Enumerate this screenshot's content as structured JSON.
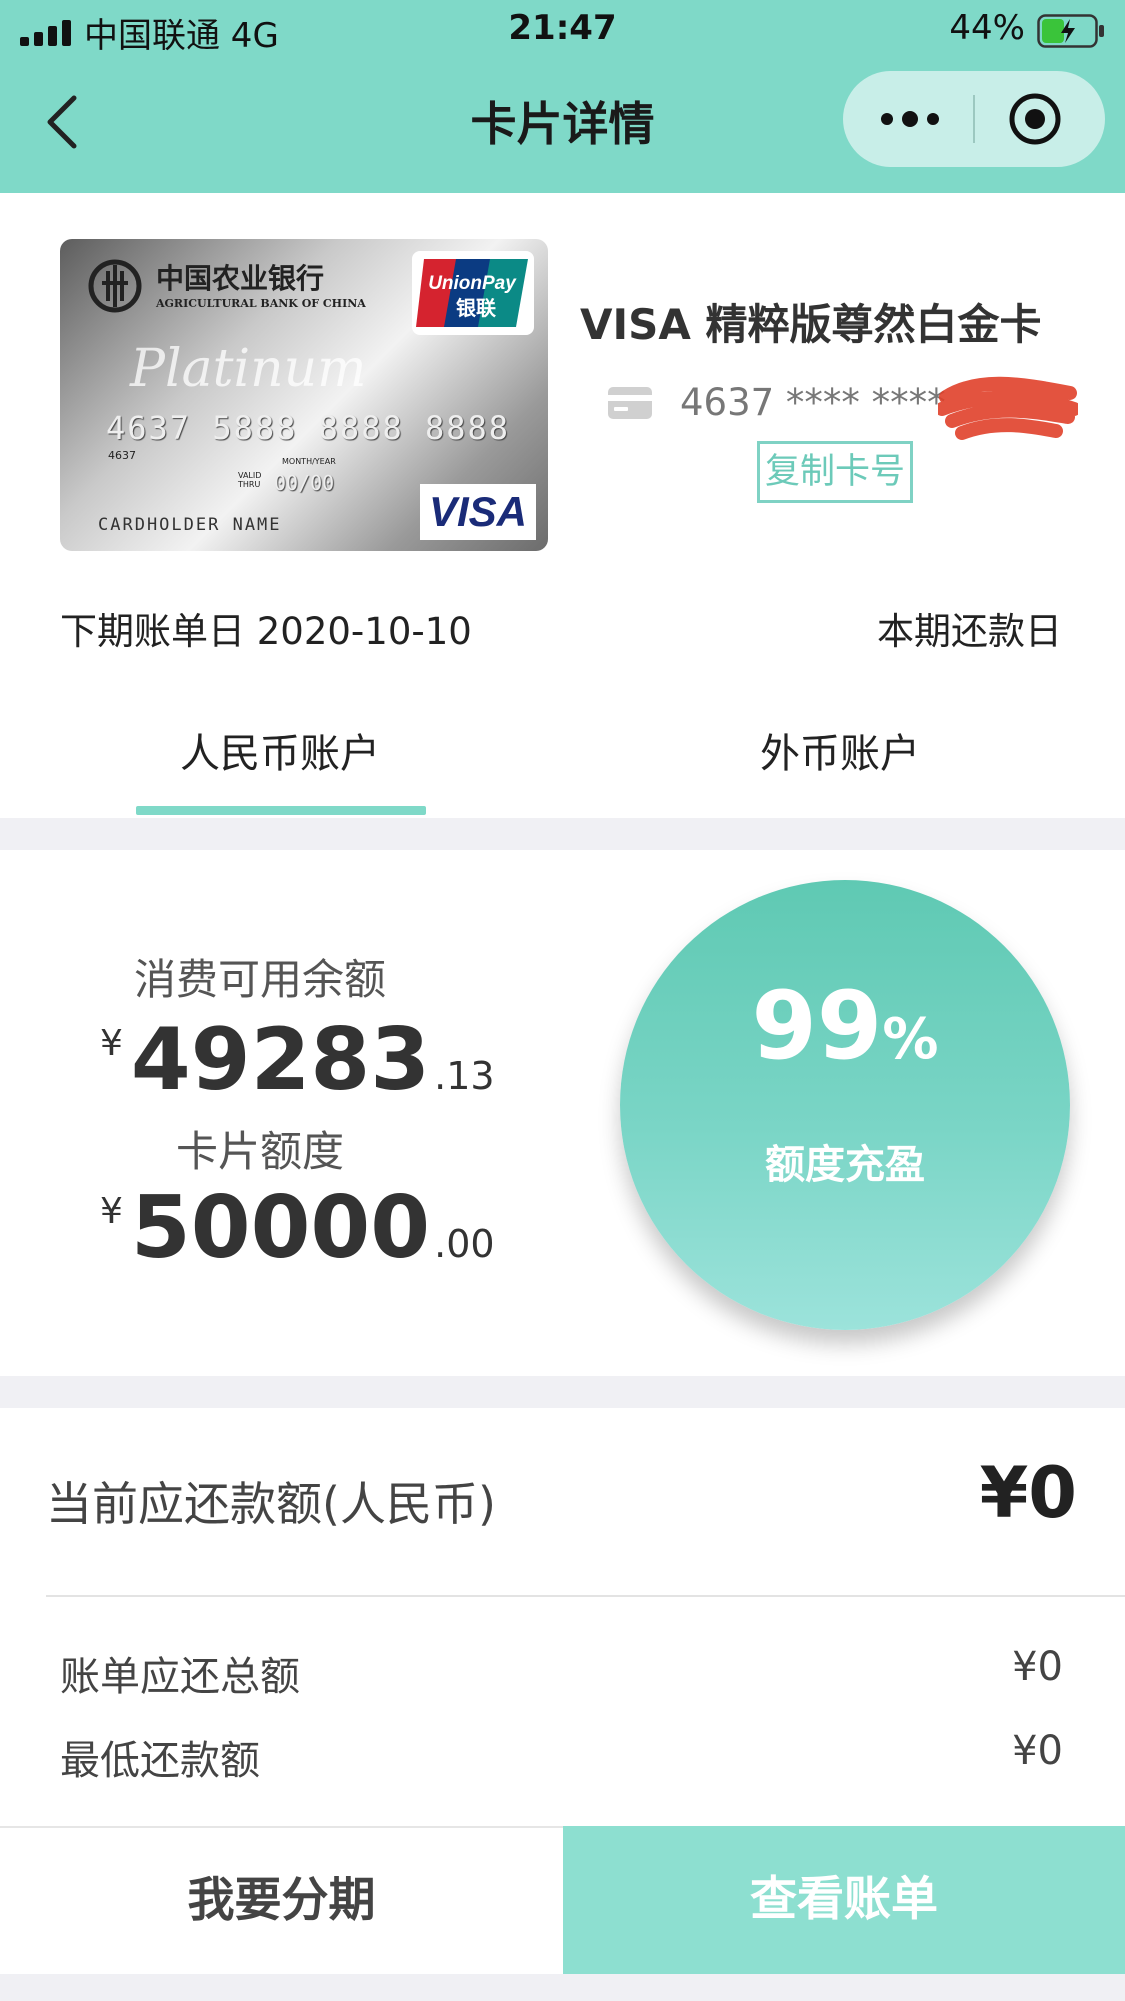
{
  "status_bar": {
    "carrier": "中国联通  4G",
    "time": "21:47",
    "battery_percent": "44%",
    "battery_level": 0.44
  },
  "nav": {
    "title": "卡片详情",
    "back_icon": "chevron-left-icon",
    "more_icon": "more-dots-icon",
    "close_icon": "target-circle-icon"
  },
  "card": {
    "image": {
      "bank_name_cn": "中国农业银行",
      "bank_name_en": "AGRICULTURAL BANK OF CHINA",
      "tier": "Platinum",
      "number": "4637 5888 8888 8888",
      "small_number": "4637",
      "valid_thru_label": "VALID THRU",
      "month_year_label": "MONTH/YEAR",
      "valid_date": "00/00",
      "holder": "CARDHOLDER  NAME",
      "unionpay_en": "UnionPay",
      "unionpay_cn": "银联",
      "network": "VISA"
    },
    "name": "VISA 精粹版尊然白金卡",
    "masked_number": "4637 **** ****",
    "copy_label": "复制卡号",
    "next_bill_label": "下期账单日 2020-10-10",
    "repay_day_label": "本期还款日"
  },
  "tabs": [
    {
      "label": "人民币账户",
      "active": true
    },
    {
      "label": "外币账户",
      "active": false
    }
  ],
  "credit": {
    "available_label": "消费可用余额",
    "available_currency": "¥",
    "available_int": "49283",
    "available_dec": ".13",
    "limit_label": "卡片额度",
    "limit_currency": "¥",
    "limit_int": "50000",
    "limit_dec": ".00",
    "percent": "99",
    "percent_sign": "%",
    "status": "额度充盈"
  },
  "repayment": {
    "current_label": "当前应还款额(人民币)",
    "current_value": "¥0",
    "total_label": "账单应还总额",
    "total_value": "¥0",
    "min_label": "最低还款额",
    "min_value": "¥0"
  },
  "buttons": {
    "installment": "我要分期",
    "view_bill": "查看账单"
  },
  "colors": {
    "accent": "#7fd9c8",
    "circle_top": "#5fc9b3",
    "circle_bottom": "#9ce3db",
    "bill_button": "#8ddfd0"
  }
}
